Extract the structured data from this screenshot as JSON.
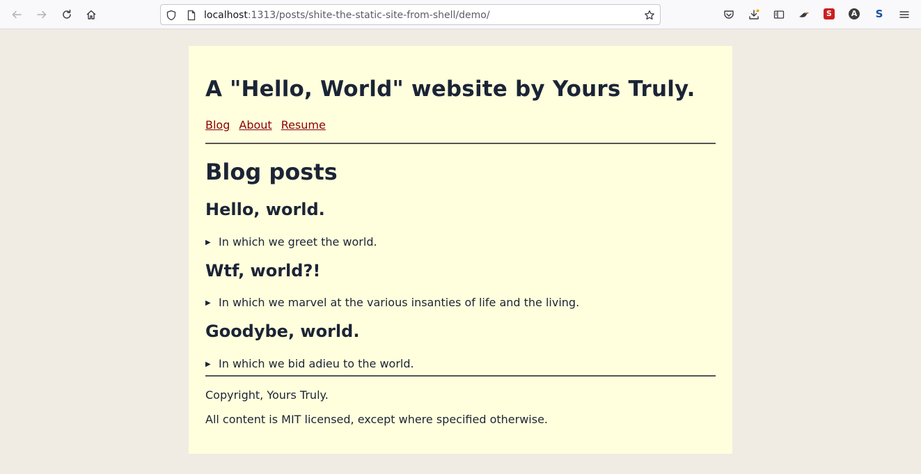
{
  "browser": {
    "url_host": "localhost",
    "url_rest": ":1313/posts/shite-the-static-site-from-shell/demo/",
    "extensions": [
      {
        "icon": "pocket-icon"
      },
      {
        "icon": "downloads-icon"
      },
      {
        "icon": "reader-view-icon"
      },
      {
        "icon": "extension-bird-icon"
      },
      {
        "icon": "extension-s-red-icon",
        "label": "S",
        "color": "#cc1f1f"
      },
      {
        "icon": "extension-a-icon",
        "label": "A",
        "color": "#3d3d3d"
      },
      {
        "icon": "extension-s-blue-icon",
        "label": "S",
        "color": "#1a4fa0"
      }
    ]
  },
  "site": {
    "title": "A \"Hello, World\" website by Yours Truly.",
    "nav": [
      "Blog",
      "About",
      "Resume"
    ]
  },
  "main": {
    "heading": "Blog posts",
    "posts": [
      {
        "title": "Hello, world.",
        "summary": "In which we greet the world."
      },
      {
        "title": "Wtf, world?!",
        "summary": "In which we marvel at the various insanties of life and the living."
      },
      {
        "title": "Goodybe, world.",
        "summary": "In which we bid adieu to the world."
      }
    ]
  },
  "footer": {
    "copyright": "Copyright, Yours Truly.",
    "license": "All content is MIT licensed, except where specified otherwise."
  },
  "colors": {
    "page_background": "#f0ebe3",
    "content_background": "#ffffdd",
    "text": "#1b2436",
    "link": "#8b0000"
  }
}
